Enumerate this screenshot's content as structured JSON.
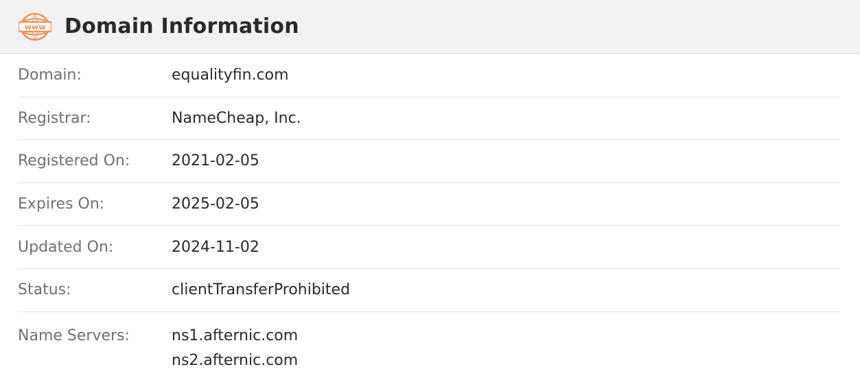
{
  "header": {
    "title": "Domain Information",
    "icon": "www-globe-icon",
    "icon_text": "www",
    "icon_color": "#f0915a"
  },
  "rows": [
    {
      "label": "Domain:",
      "value": "equalityfin.com"
    },
    {
      "label": "Registrar:",
      "value": "NameCheap, Inc."
    },
    {
      "label": "Registered On:",
      "value": "2021-02-05"
    },
    {
      "label": "Expires On:",
      "value": "2025-02-05"
    },
    {
      "label": "Updated On:",
      "value": "2024-11-02"
    },
    {
      "label": "Status:",
      "value": "clientTransferProhibited"
    }
  ],
  "name_servers": {
    "label": "Name Servers:",
    "values": [
      "ns1.afternic.com",
      "ns2.afternic.com"
    ]
  }
}
